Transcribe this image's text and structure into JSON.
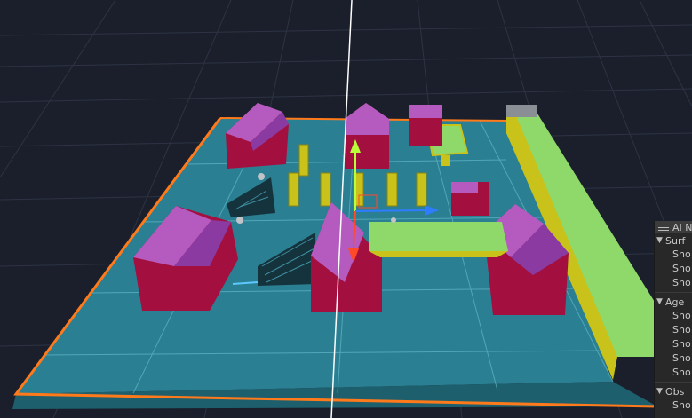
{
  "panel": {
    "title": "AI N",
    "sections": [
      {
        "label": "Surf",
        "items": [
          "Sho",
          "Sho",
          "Sho"
        ]
      },
      {
        "label": "Age",
        "items": [
          "Sho",
          "Sho",
          "Sho",
          "Sho",
          "Sho"
        ]
      },
      {
        "label": "Obs",
        "items": [
          "Sho"
        ]
      }
    ]
  },
  "colors": {
    "background": "#1b1f2b",
    "navmesh_floor": "#2a7f92",
    "building_wall": "#a3103f",
    "building_roof": "#b55bbf",
    "platform": "#8fd86a",
    "pillar": "#c9c21a",
    "selection_outline": "#ff7a1a",
    "gizmo_y": "#b8ff3a",
    "gizmo_x": "#ff4a2a",
    "gizmo_z": "#2f7cff"
  }
}
